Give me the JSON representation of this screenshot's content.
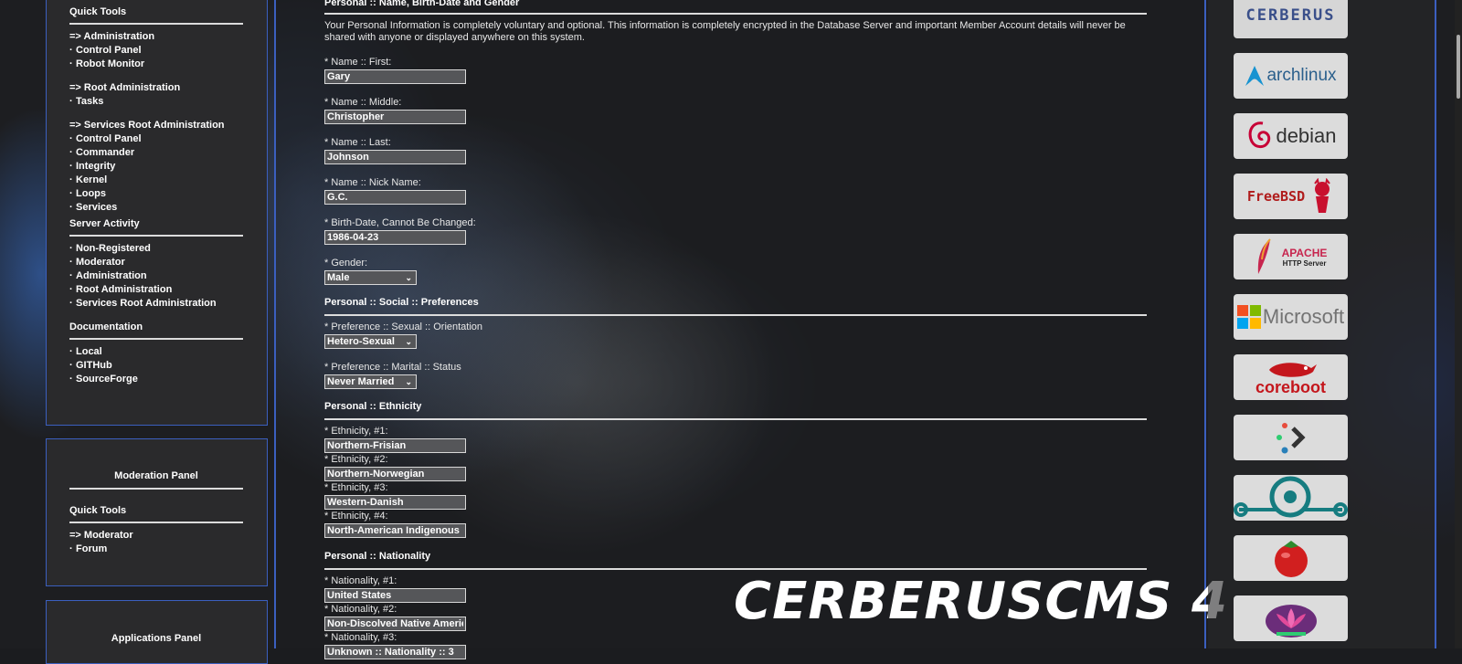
{
  "left_panels": {
    "admin_panel": {
      "quick_tools_title": "Quick Tools",
      "quick_tools": [
        {
          "label": "=> Administration",
          "type": "header"
        },
        {
          "label": "Control Panel",
          "type": "item"
        },
        {
          "label": "Robot Monitor",
          "type": "item"
        },
        {
          "label": "=> Root Administration",
          "type": "header"
        },
        {
          "label": "Tasks",
          "type": "item"
        },
        {
          "label": "=> Services Root Administration",
          "type": "header"
        },
        {
          "label": "Control Panel",
          "type": "item"
        },
        {
          "label": "Commander",
          "type": "item"
        },
        {
          "label": "Integrity",
          "type": "item"
        },
        {
          "label": "Kernel",
          "type": "item"
        },
        {
          "label": "Loops",
          "type": "item"
        },
        {
          "label": "Services",
          "type": "item"
        }
      ],
      "server_activity_title": "Server Activity",
      "server_activity": [
        "Non-Registered",
        "Moderator",
        "Administration",
        "Root Administration",
        "Services Root Administration"
      ],
      "documentation_title": "Documentation",
      "documentation": [
        "Local",
        "GITHub",
        "SourceForge"
      ]
    },
    "moderation_panel": {
      "title": "Moderation Panel",
      "quick_tools_title": "Quick Tools",
      "items": [
        {
          "label": "=> Moderator",
          "type": "header"
        },
        {
          "label": "Forum",
          "type": "item"
        }
      ]
    },
    "applications_panel": {
      "title": "Applications Panel"
    },
    "bullet": "·"
  },
  "form": {
    "section_name": "Personal :: Name, Birth-Date and Gender",
    "intro": "Your Personal Information is completely voluntary and optional. This information is completely encrypted in the Database Server and important Member Account details will never be shared with anyone or displayed anywhere on this system.",
    "name_fields": [
      {
        "label": "* Name :: First:",
        "value": "Gary"
      },
      {
        "label": "* Name :: Middle:",
        "value": "Christopher"
      },
      {
        "label": "* Name :: Last:",
        "value": "Johnson"
      },
      {
        "label": "* Name :: Nick Name:",
        "value": "G.C."
      },
      {
        "label": "* Birth-Date, Cannot Be Changed:",
        "value": "1986-04-23"
      }
    ],
    "gender_label": "* Gender:",
    "gender_value": "Male",
    "section_social": "Personal :: Social :: Preferences",
    "orientation_label": "* Preference :: Sexual :: Orientation",
    "orientation_value": "Hetero-Sexual",
    "marital_label": "* Preference :: Marital :: Status",
    "marital_value": "Never Married",
    "section_ethnicity": "Personal :: Ethnicity",
    "ethnicity_fields": [
      {
        "label": "* Ethnicity, #1:",
        "value": "Northern-Frisian"
      },
      {
        "label": "* Ethnicity, #2:",
        "value": "Northern-Norwegian"
      },
      {
        "label": "* Ethnicity, #3:",
        "value": "Western-Danish"
      },
      {
        "label": "* Ethnicity, #4:",
        "value": "North-American Indigenous"
      }
    ],
    "section_nationality": "Personal :: Nationality",
    "nationality_fields": [
      {
        "label": "* Nationality, #1:",
        "value": "United States"
      },
      {
        "label": "* Nationality, #2:",
        "value": "Non-Discolved Native Americ"
      },
      {
        "label": "* Nationality, #3:",
        "value": "Unknown :: Nationality :: 3"
      }
    ]
  },
  "watermark": "CERBERUSCMS 4",
  "logos": [
    {
      "name": "cerberus-logo",
      "text": "CERBERUS"
    },
    {
      "name": "archlinux-logo",
      "text": "archlinux"
    },
    {
      "name": "debian-logo",
      "text": "debian"
    },
    {
      "name": "freebsd-logo",
      "text": "FreeBSD"
    },
    {
      "name": "apache-logo",
      "text": "APACHE",
      "subtext": "HTTP Server"
    },
    {
      "name": "microsoft-logo",
      "text": "Microsoft"
    },
    {
      "name": "coreboot-logo",
      "text": "coreboot"
    },
    {
      "name": "dots-logo",
      "text": ""
    },
    {
      "name": "lineageos-logo",
      "text": ""
    },
    {
      "name": "tomato-logo",
      "text": ""
    },
    {
      "name": "lotus-logo",
      "text": ""
    }
  ],
  "colors": {
    "panel_border": "#3b5fbf",
    "panel_bg": "#2a2a2c",
    "input_bg": "#555659"
  }
}
